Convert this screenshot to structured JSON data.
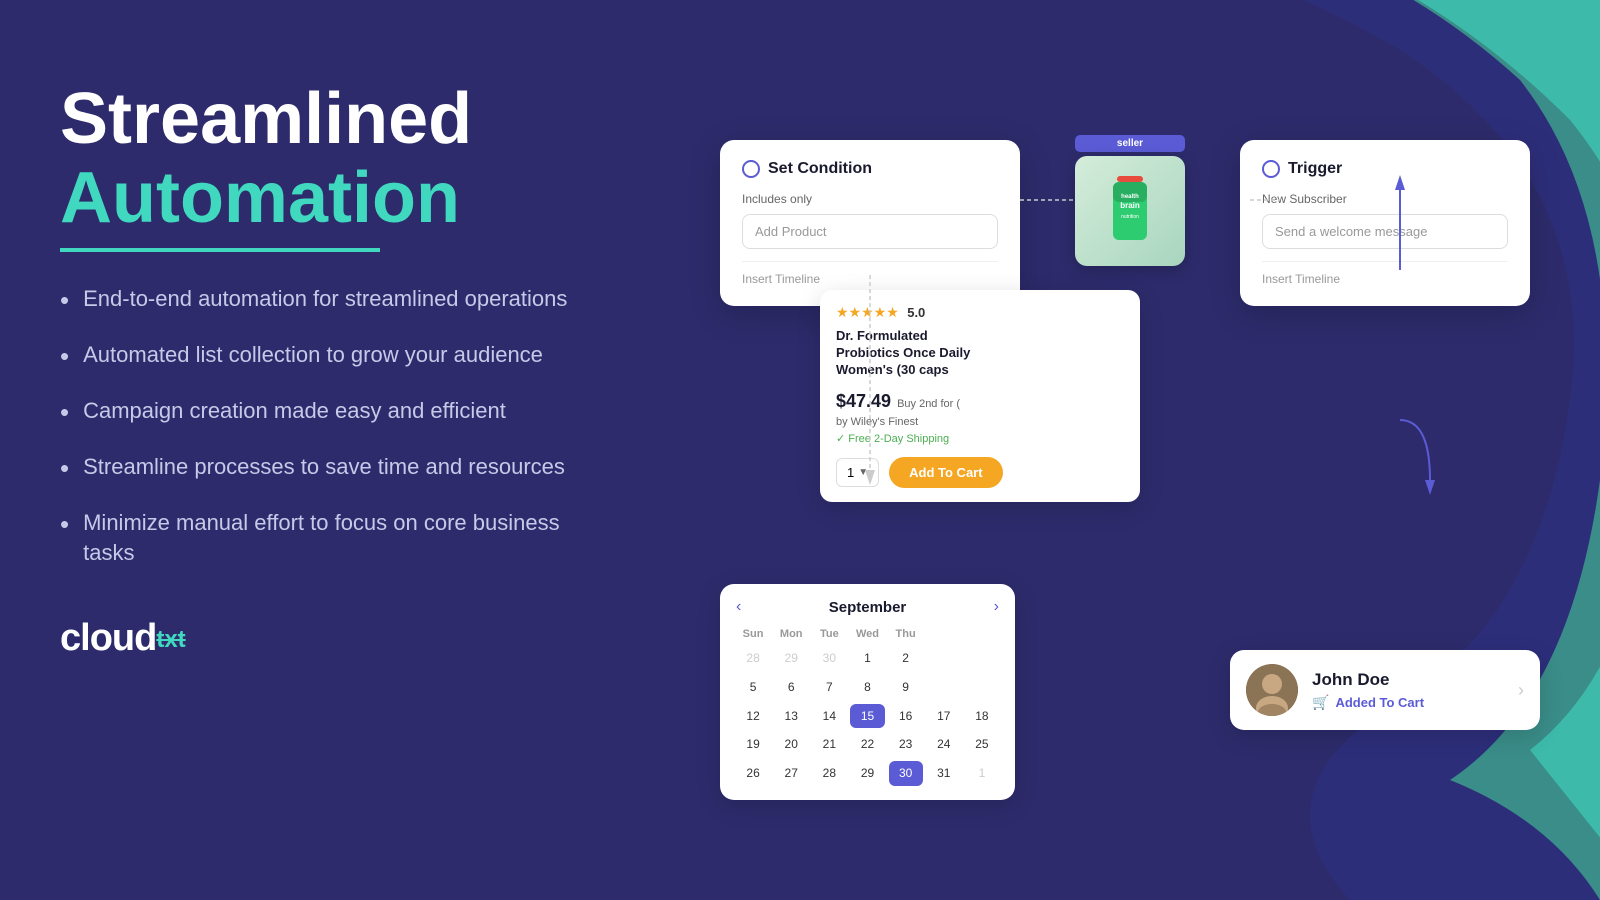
{
  "page": {
    "background_color": "#2d2b6b"
  },
  "left": {
    "title_line1": "Streamlined",
    "title_line2": "Automation",
    "bullets": [
      "End-to-end automation for streamlined operations",
      "Automated list collection to grow your audience",
      "Campaign creation made easy and efficient",
      "Streamline processes to save time and resources",
      "Minimize manual effort to focus on core business tasks"
    ],
    "logo_cloud": "cloud",
    "logo_txt": "txt"
  },
  "condition_card": {
    "title": "Set Condition",
    "label": "Includes only",
    "input_placeholder": "Add Product",
    "footer": "Insert Timeline"
  },
  "trigger_card": {
    "title": "Trigger",
    "label": "New Subscriber",
    "input_placeholder": "Send a welcome message",
    "footer": "Insert Timeline"
  },
  "product_label": "seller",
  "amazon_product": {
    "stars": "★★★★★",
    "rating": "5.0",
    "title_line1": "Dr. Formulated",
    "title_line2": "Probiotics Once Daily",
    "title_line3": "Women's (30 caps",
    "price": "$47.49",
    "price_note": "Buy 2nd for (",
    "seller": "by Wiley's Finest",
    "shipping": "✓ Free 2-Day Shipping",
    "qty_label": "1",
    "add_cart": "Add To Cart"
  },
  "calendar": {
    "month": "September",
    "day_headers": [
      "Sun",
      "Mon",
      "Tue",
      "Wed",
      "Thu"
    ],
    "weeks": [
      [
        "28",
        "29",
        "30",
        "1",
        "2"
      ],
      [
        "5",
        "6",
        "7",
        "8",
        "9"
      ],
      [
        "12",
        "13",
        "14",
        "15",
        "16",
        "17",
        "18"
      ],
      [
        "19",
        "20",
        "21",
        "22",
        "23",
        "24",
        "25"
      ],
      [
        "26",
        "27",
        "28",
        "29",
        "30",
        "31",
        "1"
      ]
    ],
    "today": "15",
    "highlighted": "30"
  },
  "notification": {
    "name": "John Doe",
    "status": "Added To Cart"
  }
}
